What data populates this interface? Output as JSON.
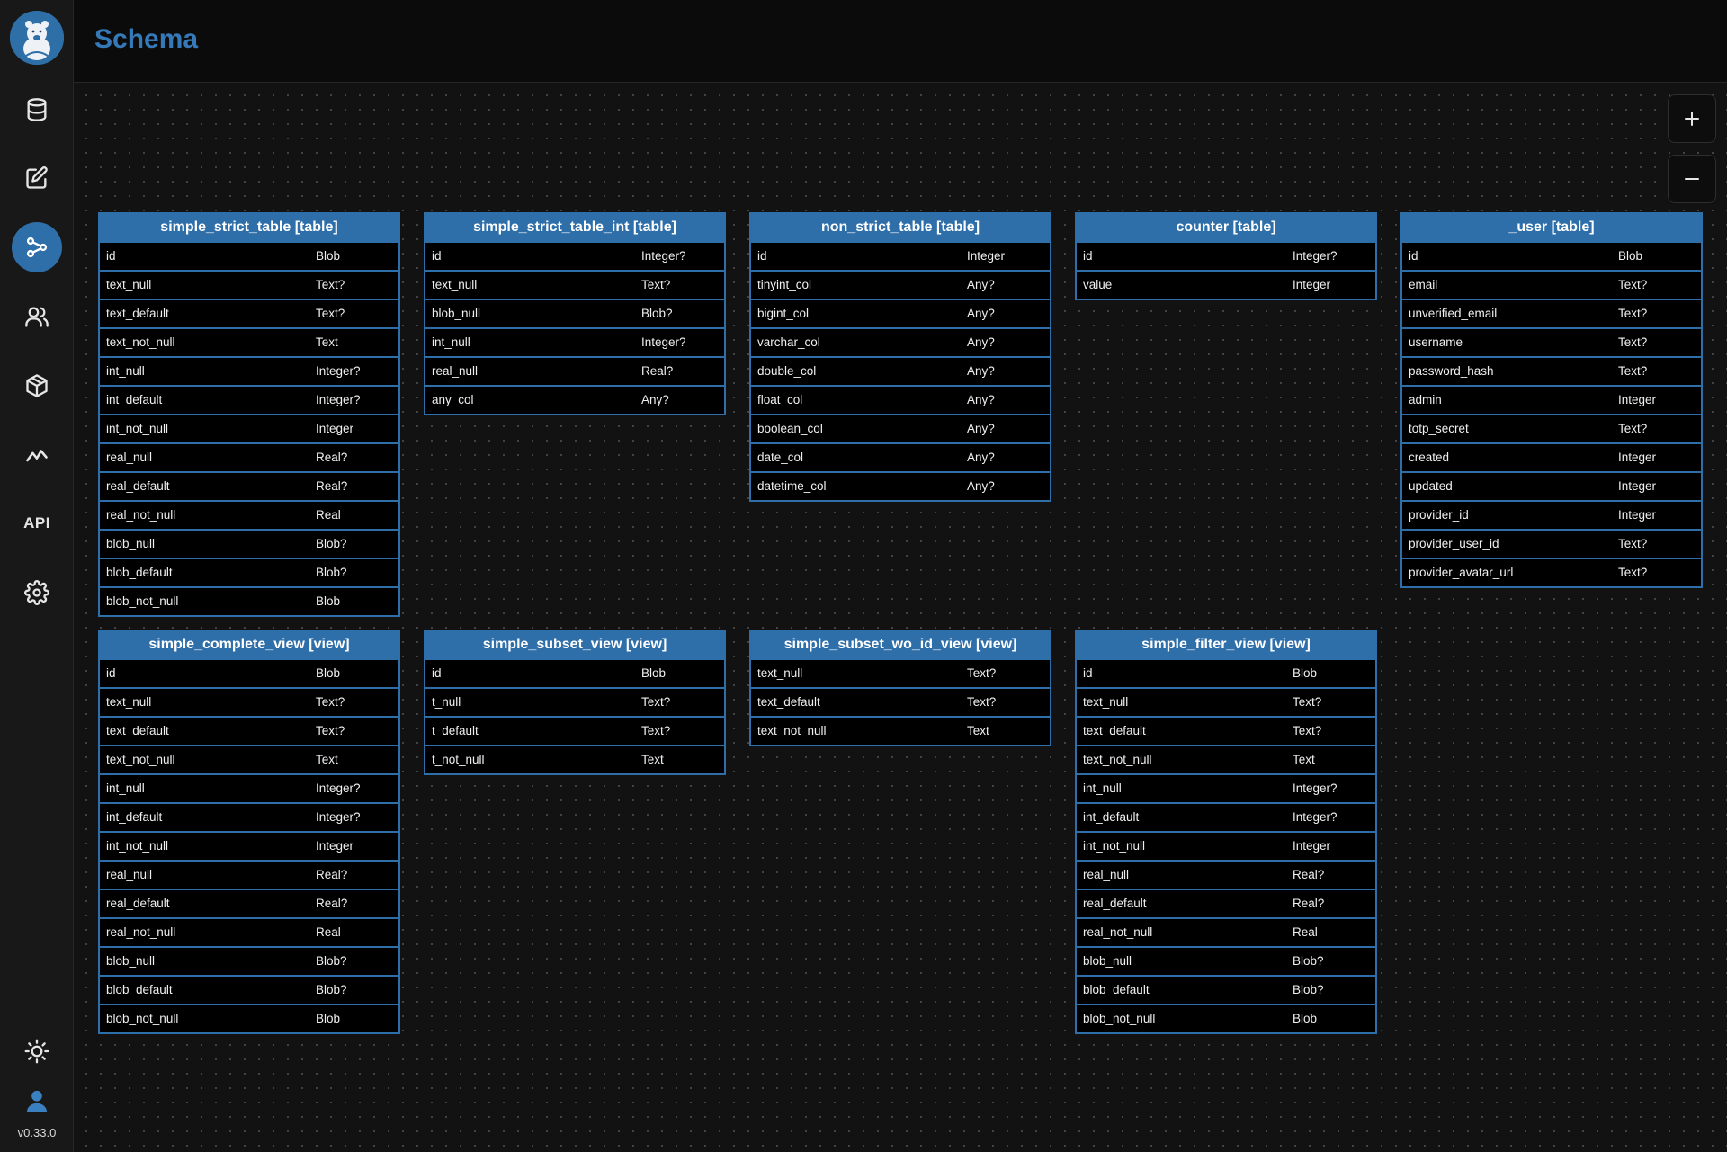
{
  "app": {
    "title": "Schema",
    "version": "v0.33.0"
  },
  "sidebar": {
    "items": [
      {
        "name": "database",
        "icon": "database-icon"
      },
      {
        "name": "editor",
        "icon": "edit-icon"
      },
      {
        "name": "schema",
        "icon": "schema-graph-icon",
        "active": true
      },
      {
        "name": "accounts",
        "icon": "users-icon"
      },
      {
        "name": "wasm",
        "icon": "package-icon"
      },
      {
        "name": "logs",
        "icon": "chart-line-icon"
      },
      {
        "name": "api",
        "label": "API"
      },
      {
        "name": "settings",
        "icon": "gear-icon"
      }
    ],
    "theme_icon": "sun-icon",
    "user_icon": "user-icon"
  },
  "colors": {
    "accent": "#2e6ea9",
    "title": "#3579b8",
    "background": "#121212"
  },
  "zoom": {
    "in_icon": "plus-icon",
    "out_icon": "minus-icon"
  },
  "tables": [
    {
      "title": "simple_strict_table [table]",
      "columns": [
        {
          "name": "id",
          "type": "Blob"
        },
        {
          "name": "text_null",
          "type": "Text?"
        },
        {
          "name": "text_default",
          "type": "Text?"
        },
        {
          "name": "text_not_null",
          "type": "Text"
        },
        {
          "name": "int_null",
          "type": "Integer?"
        },
        {
          "name": "int_default",
          "type": "Integer?"
        },
        {
          "name": "int_not_null",
          "type": "Integer"
        },
        {
          "name": "real_null",
          "type": "Real?"
        },
        {
          "name": "real_default",
          "type": "Real?"
        },
        {
          "name": "real_not_null",
          "type": "Real"
        },
        {
          "name": "blob_null",
          "type": "Blob?"
        },
        {
          "name": "blob_default",
          "type": "Blob?"
        },
        {
          "name": "blob_not_null",
          "type": "Blob"
        }
      ]
    },
    {
      "title": "simple_strict_table_int [table]",
      "columns": [
        {
          "name": "id",
          "type": "Integer?"
        },
        {
          "name": "text_null",
          "type": "Text?"
        },
        {
          "name": "blob_null",
          "type": "Blob?"
        },
        {
          "name": "int_null",
          "type": "Integer?"
        },
        {
          "name": "real_null",
          "type": "Real?"
        },
        {
          "name": "any_col",
          "type": "Any?"
        }
      ]
    },
    {
      "title": "non_strict_table [table]",
      "columns": [
        {
          "name": "id",
          "type": "Integer"
        },
        {
          "name": "tinyint_col",
          "type": "Any?"
        },
        {
          "name": "bigint_col",
          "type": "Any?"
        },
        {
          "name": "varchar_col",
          "type": "Any?"
        },
        {
          "name": "double_col",
          "type": "Any?"
        },
        {
          "name": "float_col",
          "type": "Any?"
        },
        {
          "name": "boolean_col",
          "type": "Any?"
        },
        {
          "name": "date_col",
          "type": "Any?"
        },
        {
          "name": "datetime_col",
          "type": "Any?"
        }
      ]
    },
    {
      "title": "counter [table]",
      "columns": [
        {
          "name": "id",
          "type": "Integer?"
        },
        {
          "name": "value",
          "type": "Integer"
        }
      ]
    },
    {
      "title": "_user [table]",
      "columns": [
        {
          "name": "id",
          "type": "Blob"
        },
        {
          "name": "email",
          "type": "Text?"
        },
        {
          "name": "unverified_email",
          "type": "Text?"
        },
        {
          "name": "username",
          "type": "Text?"
        },
        {
          "name": "password_hash",
          "type": "Text?"
        },
        {
          "name": "admin",
          "type": "Integer"
        },
        {
          "name": "totp_secret",
          "type": "Text?"
        },
        {
          "name": "created",
          "type": "Integer"
        },
        {
          "name": "updated",
          "type": "Integer"
        },
        {
          "name": "provider_id",
          "type": "Integer"
        },
        {
          "name": "provider_user_id",
          "type": "Text?"
        },
        {
          "name": "provider_avatar_url",
          "type": "Text?"
        }
      ]
    },
    {
      "title": "simple_complete_view [view]",
      "columns": [
        {
          "name": "id",
          "type": "Blob"
        },
        {
          "name": "text_null",
          "type": "Text?"
        },
        {
          "name": "text_default",
          "type": "Text?"
        },
        {
          "name": "text_not_null",
          "type": "Text"
        },
        {
          "name": "int_null",
          "type": "Integer?"
        },
        {
          "name": "int_default",
          "type": "Integer?"
        },
        {
          "name": "int_not_null",
          "type": "Integer"
        },
        {
          "name": "real_null",
          "type": "Real?"
        },
        {
          "name": "real_default",
          "type": "Real?"
        },
        {
          "name": "real_not_null",
          "type": "Real"
        },
        {
          "name": "blob_null",
          "type": "Blob?"
        },
        {
          "name": "blob_default",
          "type": "Blob?"
        },
        {
          "name": "blob_not_null",
          "type": "Blob"
        }
      ]
    },
    {
      "title": "simple_subset_view [view]",
      "columns": [
        {
          "name": "id",
          "type": "Blob"
        },
        {
          "name": "t_null",
          "type": "Text?"
        },
        {
          "name": "t_default",
          "type": "Text?"
        },
        {
          "name": "t_not_null",
          "type": "Text"
        }
      ]
    },
    {
      "title": "simple_subset_wo_id_view [view]",
      "columns": [
        {
          "name": "text_null",
          "type": "Text?"
        },
        {
          "name": "text_default",
          "type": "Text?"
        },
        {
          "name": "text_not_null",
          "type": "Text"
        }
      ]
    },
    {
      "title": "simple_filter_view [view]",
      "columns": [
        {
          "name": "id",
          "type": "Blob"
        },
        {
          "name": "text_null",
          "type": "Text?"
        },
        {
          "name": "text_default",
          "type": "Text?"
        },
        {
          "name": "text_not_null",
          "type": "Text"
        },
        {
          "name": "int_null",
          "type": "Integer?"
        },
        {
          "name": "int_default",
          "type": "Integer?"
        },
        {
          "name": "int_not_null",
          "type": "Integer"
        },
        {
          "name": "real_null",
          "type": "Real?"
        },
        {
          "name": "real_default",
          "type": "Real?"
        },
        {
          "name": "real_not_null",
          "type": "Real"
        },
        {
          "name": "blob_null",
          "type": "Blob?"
        },
        {
          "name": "blob_default",
          "type": "Blob?"
        },
        {
          "name": "blob_not_null",
          "type": "Blob"
        }
      ]
    }
  ]
}
